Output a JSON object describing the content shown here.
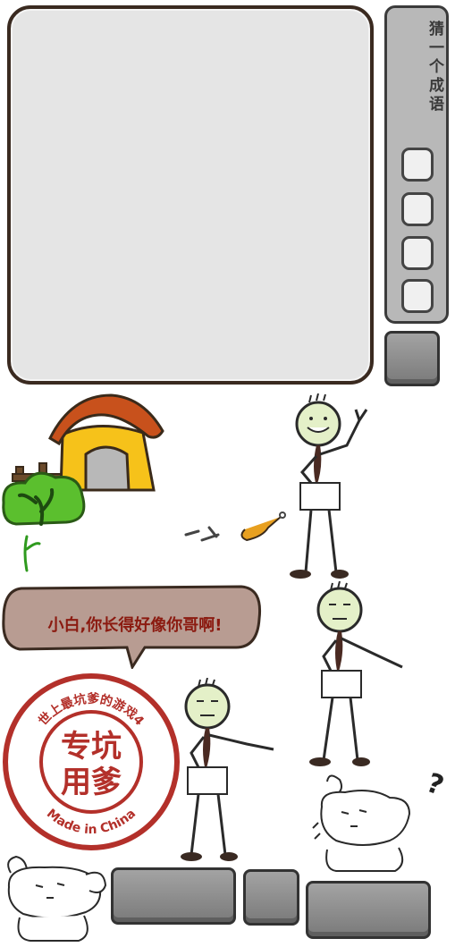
{
  "game": {
    "side_title": "猜一个成语",
    "answer_slots": [
      "",
      "",
      "",
      ""
    ],
    "dialog_text": "小白,你长得好像你哥啊!",
    "stamp": {
      "top_text": "世上最坑爹的游戏4",
      "center_line1": "专坑",
      "center_line2": "用爹",
      "bottom_text": "Made in China"
    },
    "question_mark": "?"
  },
  "colors": {
    "panel_bg": "#e5e5e5",
    "side_panel_bg": "#b8b8b8",
    "roof": "#c8511c",
    "house": "#f6c21a",
    "bush": "#5bbf2e",
    "stamp_red": "#b3302a",
    "bubble": "#b89c92",
    "dialog_text": "#8b1a10"
  }
}
